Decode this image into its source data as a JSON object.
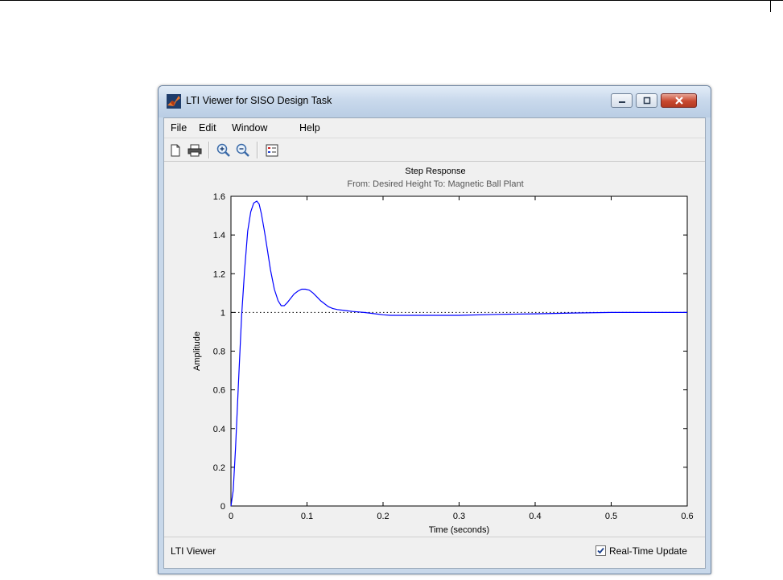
{
  "window": {
    "title": "LTI Viewer for SISO Design Task"
  },
  "menu": {
    "items": [
      {
        "label": "File"
      },
      {
        "label": "Edit"
      },
      {
        "label": "Window"
      },
      {
        "label": "Help"
      }
    ]
  },
  "toolbar": {
    "buttons": [
      "new-icon",
      "print-icon",
      "zoom-in-icon",
      "zoom-out-icon",
      "legend-icon"
    ]
  },
  "status": {
    "label": "LTI Viewer",
    "realtime_label": "Real-Time Update",
    "realtime_checked": true
  },
  "chart_data": {
    "type": "line",
    "title": "Step Response",
    "subtitle": "From: Desired Height  To: Magnetic Ball Plant",
    "xlabel": "Time (seconds)",
    "ylabel": "Amplitude",
    "xlim": [
      0,
      0.6
    ],
    "ylim": [
      0,
      1.6
    ],
    "xticks": [
      "0",
      "0.1",
      "0.2",
      "0.3",
      "0.4",
      "0.5",
      "0.6"
    ],
    "yticks": [
      "0",
      "0.2",
      "0.4",
      "0.6",
      "0.8",
      "1",
      "1.2",
      "1.4",
      "1.6"
    ],
    "grid": false,
    "series": [
      {
        "color": "#0000ff",
        "x": [
          0,
          0.003,
          0.006,
          0.01,
          0.014,
          0.018,
          0.022,
          0.026,
          0.03,
          0.034,
          0.037,
          0.04,
          0.044,
          0.048,
          0.052,
          0.057,
          0.062,
          0.066,
          0.07,
          0.074,
          0.078,
          0.083,
          0.088,
          0.093,
          0.098,
          0.103,
          0.108,
          0.113,
          0.118,
          0.123,
          0.128,
          0.134,
          0.14,
          0.15,
          0.16,
          0.175,
          0.19,
          0.2,
          0.21,
          0.22,
          0.25,
          0.3,
          0.35,
          0.4,
          0.45,
          0.5,
          0.55,
          0.6
        ],
        "y": [
          0,
          0.08,
          0.3,
          0.65,
          0.98,
          1.22,
          1.42,
          1.52,
          1.565,
          1.575,
          1.56,
          1.51,
          1.42,
          1.32,
          1.22,
          1.12,
          1.06,
          1.035,
          1.035,
          1.05,
          1.07,
          1.095,
          1.11,
          1.12,
          1.12,
          1.115,
          1.1,
          1.08,
          1.06,
          1.045,
          1.03,
          1.02,
          1.015,
          1.01,
          1.005,
          1.0,
          0.993,
          0.988,
          0.985,
          0.985,
          0.985,
          0.985,
          0.99,
          0.993,
          0.997,
          1.0,
          1.0,
          1.0
        ]
      }
    ],
    "reference_line": {
      "y": 1,
      "style": "dotted",
      "color": "#000000"
    }
  }
}
